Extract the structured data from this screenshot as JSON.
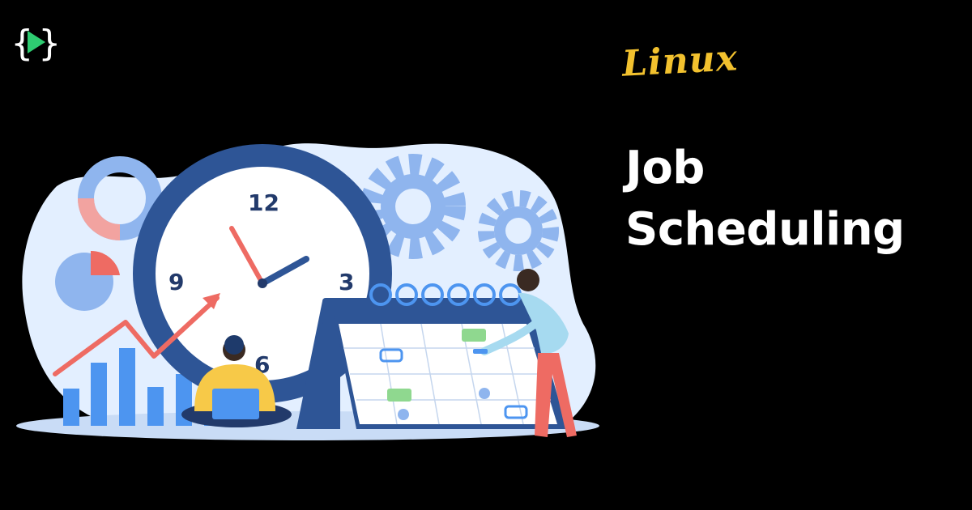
{
  "brand": {
    "logo_icon": "code-play-icon",
    "accent": "#2ecc71"
  },
  "tag": "Linux",
  "headline": {
    "line1": "Job",
    "line2": "Scheduling"
  },
  "clock": {
    "n12": "12",
    "n3": "3",
    "n6": "6",
    "n9": "9"
  },
  "colors": {
    "background": "#000000",
    "tag": "#f2c12e",
    "headline": "#ffffff",
    "blob": "#e3efff",
    "clock_rim": "#2e5596",
    "gear": "#8fb5ee",
    "bars": "#4d95f0",
    "arrow": "#ee6b63"
  }
}
